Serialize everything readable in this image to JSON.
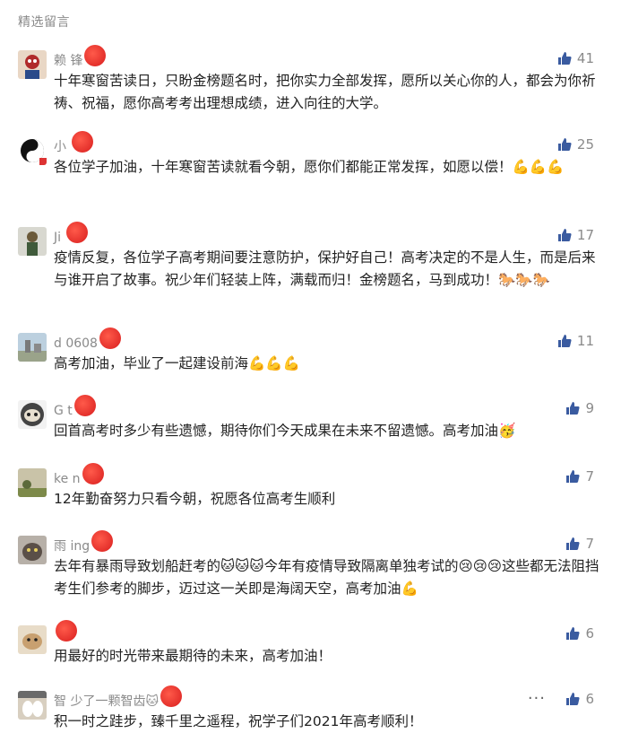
{
  "section_title": "精选留言",
  "colors": {
    "like_icon": "#3a5ba0",
    "meta_text": "#8a8a8a",
    "body_text": "#222222"
  },
  "comments": [
    {
      "name": "赖  锋",
      "text": "十年寒窗苦读日，只盼金榜题名时，把你实力全部发挥，愿所以关心你的人，都会为你祈祷、祝福，愿你高考考出理想成绩，进入向往的大学。",
      "likes": "41",
      "avatar_icon": "avatar-cartoon-icon"
    },
    {
      "name": "小  ",
      "text": "各位学子加油，十年寒窗苦读就看今朝，愿你们都能正常发挥，如愿以偿！💪💪💪",
      "likes": "25",
      "avatar_icon": "avatar-yinyang-icon"
    },
    {
      "name": "Ji  ",
      "text": "疫情反复，各位学子高考期间要注意防护，保护好自己！高考决定的不是人生，而是后来与谁开启了故事。祝少年们轻装上阵，满载而归！金榜题名，马到成功！🐎🐎🐎",
      "likes": "17",
      "avatar_icon": "avatar-person-icon"
    },
    {
      "name": "d   0608",
      "text": "高考加油，毕业了一起建设前海💪💪💪",
      "likes": "11",
      "avatar_icon": "avatar-building-icon"
    },
    {
      "name": "G   t",
      "text": "回首高考时多少有些遗憾，期待你们今天成果在未来不留遗憾。高考加油🥳",
      "likes": "9",
      "avatar_icon": "avatar-sloth-icon"
    },
    {
      "name": "ke  n",
      "text": "12年勤奋努力只看今朝，祝愿各位高考生顺利",
      "likes": "7",
      "avatar_icon": "avatar-landscape-icon"
    },
    {
      "name": "雨   ing",
      "text": "去年有暴雨导致划船赶考的🐱🐱🐱今年有疫情导致隔离单独考试的😢😢😢这些都无法阻挡考生们参考的脚步，迈过这一关即是海阔天空，高考加油💪",
      "likes": "7",
      "avatar_icon": "avatar-cat-icon"
    },
    {
      "name": "",
      "text": "用最好的时光带来最期待的未来，高考加油！",
      "likes": "6",
      "avatar_icon": "avatar-dog-icon"
    },
    {
      "name": "智      少了一颗智齿🐱",
      "text": "积一时之跬步，臻千里之遥程，祝学子们2021年高考顺利！",
      "likes": "6",
      "avatar_icon": "avatar-paw-icon",
      "more": "···"
    }
  ]
}
